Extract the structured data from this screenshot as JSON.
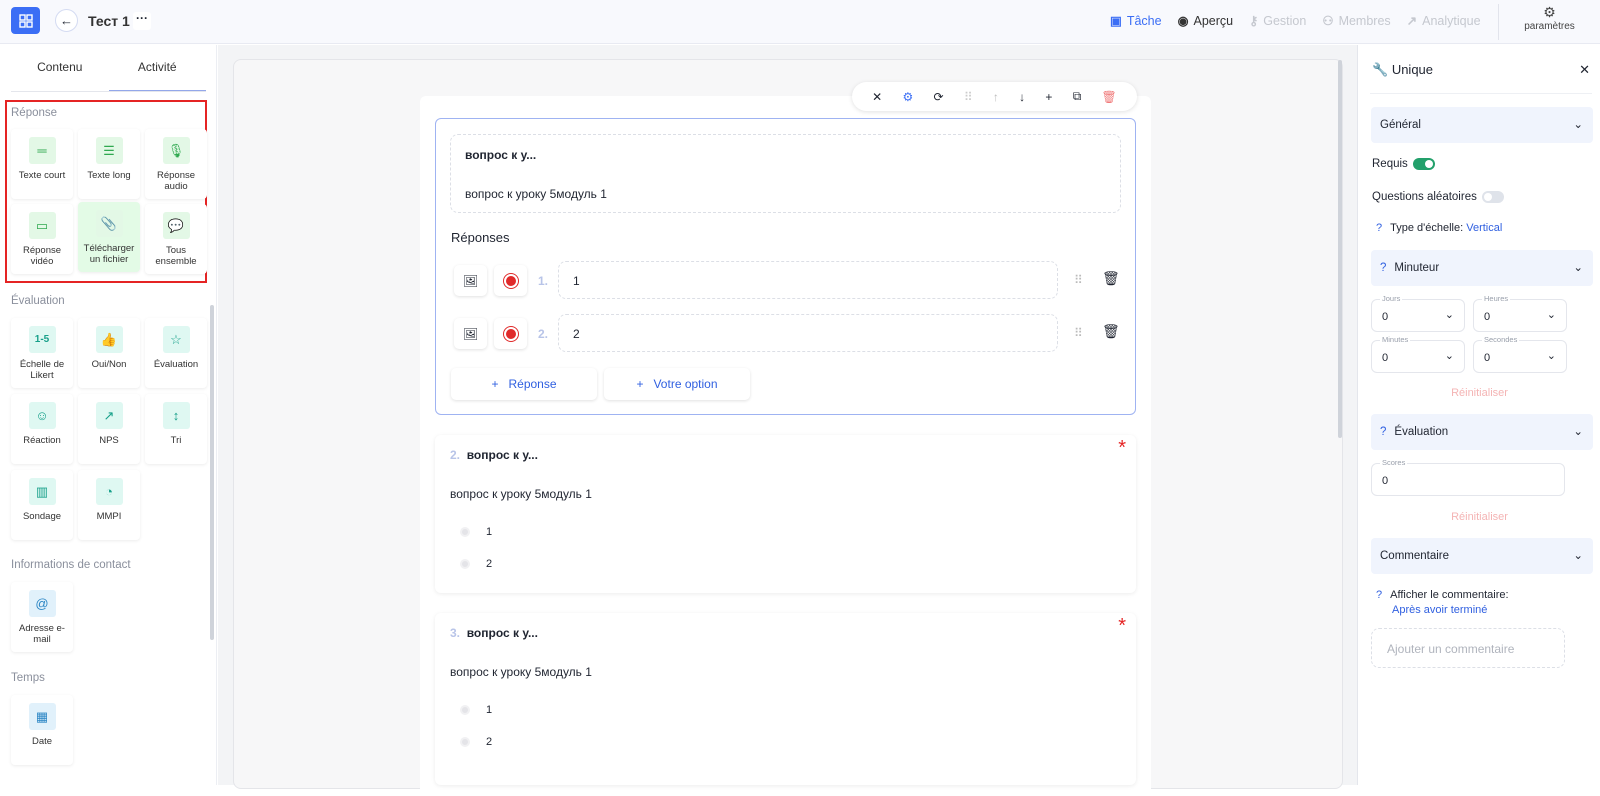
{
  "header": {
    "title": "Тест 1",
    "more": "···",
    "nav": [
      {
        "label": "Tâche",
        "icon": "briefcase-icon",
        "color": "#3b6ef5"
      },
      {
        "label": "Aperçu",
        "icon": "eye-icon",
        "color": "#333"
      },
      {
        "label": "Gestion",
        "icon": "key-icon",
        "color": "#c5c8cf"
      },
      {
        "label": "Membres",
        "icon": "users-icon",
        "color": "#c5c8cf"
      },
      {
        "label": "Analytique",
        "icon": "trend-icon",
        "color": "#c5c8cf"
      }
    ],
    "settings": "paramètres"
  },
  "sidebar": {
    "tabs": [
      "Contenu",
      "Activité"
    ],
    "sections": [
      {
        "title": "Réponse",
        "items": [
          "Texte court",
          "Texte long",
          "Réponse audio",
          "Réponse vidéo",
          "Télécharger un fichier",
          "Tous ensemble"
        ]
      },
      {
        "title": "Évaluation",
        "items": [
          "Échelle de Likert",
          "Oui/Non",
          "Évaluation",
          "Réaction",
          "NPS",
          "Tri",
          "Sondage",
          "MMPI"
        ]
      },
      {
        "title": "Informations de contact",
        "items": [
          "Adresse e-mail"
        ]
      },
      {
        "title": "Temps",
        "items": [
          "Date"
        ]
      }
    ],
    "likert_glyph": "1-5"
  },
  "editor": {
    "q1": {
      "title": "вопрос к у...",
      "text": "вопрос к уроку 5модуль 1",
      "answers_label": "Réponses",
      "answers": [
        {
          "num": "1.",
          "value": "1"
        },
        {
          "num": "2.",
          "value": "2"
        }
      ],
      "add_answer": "Réponse",
      "add_option": "Votre option"
    },
    "questions": [
      {
        "num": "2.",
        "title": "вопрос к у...",
        "text": "вопрос к уроку 5модуль 1",
        "options": [
          "1",
          "2"
        ],
        "required": "*"
      },
      {
        "num": "3.",
        "title": "вопрос к у...",
        "text": "вопрос к уроку 5модуль 1",
        "options": [
          "1",
          "2"
        ],
        "required": "*"
      }
    ]
  },
  "panel": {
    "title": "Unique",
    "general": "Général",
    "required": "Requis",
    "required_on": true,
    "random": "Questions aléatoires",
    "random_on": false,
    "scale_label": "Type d'échelle:",
    "scale_value": "Vertical",
    "timer": "Minuteur",
    "days_label": "Jours",
    "days": "0",
    "hours_label": "Heures",
    "hours": "0",
    "minutes_label": "Minutes",
    "minutes": "0",
    "seconds_label": "Secondes",
    "seconds": "0",
    "reset": "Réinitialiser",
    "evaluation": "Évaluation",
    "scores_label": "Scores",
    "scores": "0",
    "comment": "Commentaire",
    "show_comment": "Afficher le commentaire:",
    "show_comment_value": "Après avoir terminé",
    "comment_placeholder": "Ajouter un commentaire",
    "help": "?"
  }
}
